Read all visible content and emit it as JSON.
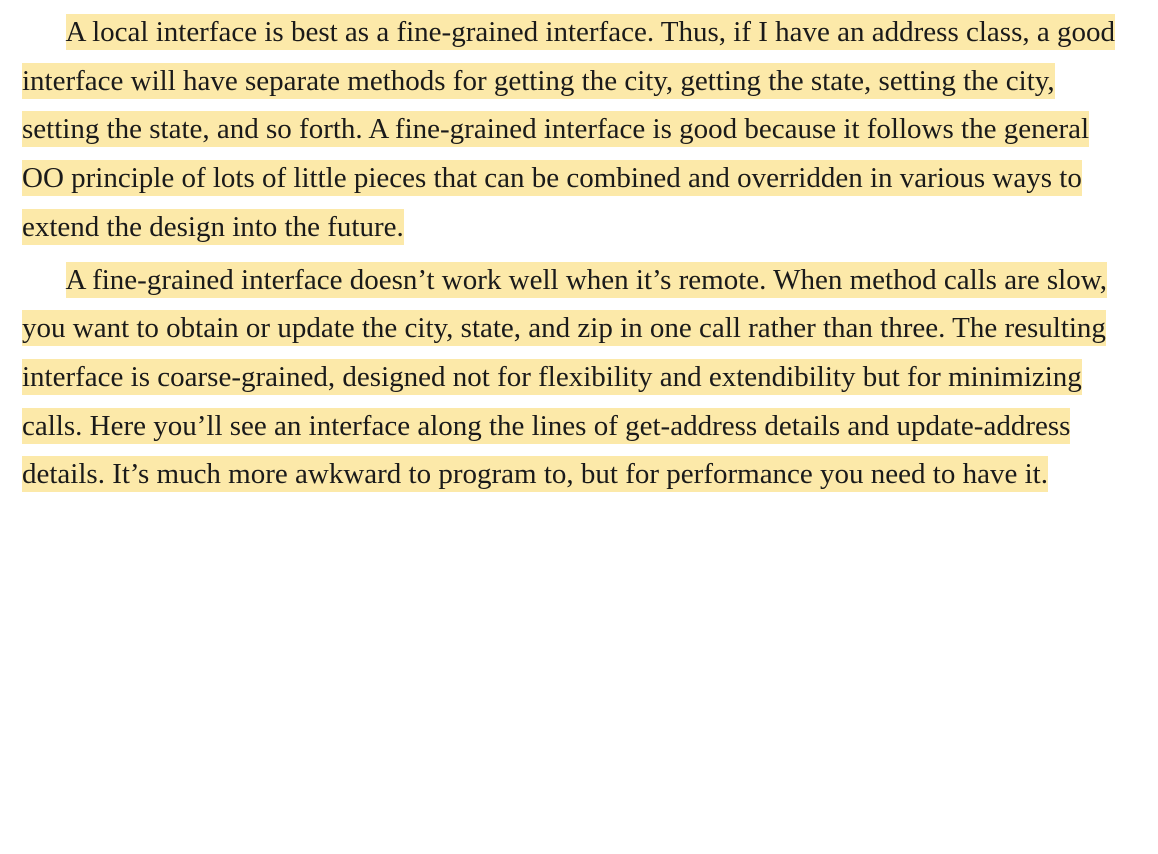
{
  "paragraphs": [
    {
      "text": "A local interface is best as a fine-grained interface. Thus, if I have an address class, a good interface will have separate methods for getting the city, getting the state, setting the city, setting the state, and so forth. A fine-grained interface is good because it follows the general OO principle of lots of little pieces that can be combined and overridden in various ways to extend the design into the future.",
      "highlighted": true
    },
    {
      "text": "A fine-grained interface doesn’t work well when it’s remote. When method calls are slow, you want to obtain or update the city, state, and zip in one call rather than three. The resulting interface is coarse-grained, designed not for flexibility and extendibility but for minimizing calls. Here you’ll see an interface along the lines of get-address details and update-address details. It’s much more awkward to program to, but for performance you need to have it.",
      "highlighted": true
    }
  ],
  "highlight_color": "#fce9a9"
}
